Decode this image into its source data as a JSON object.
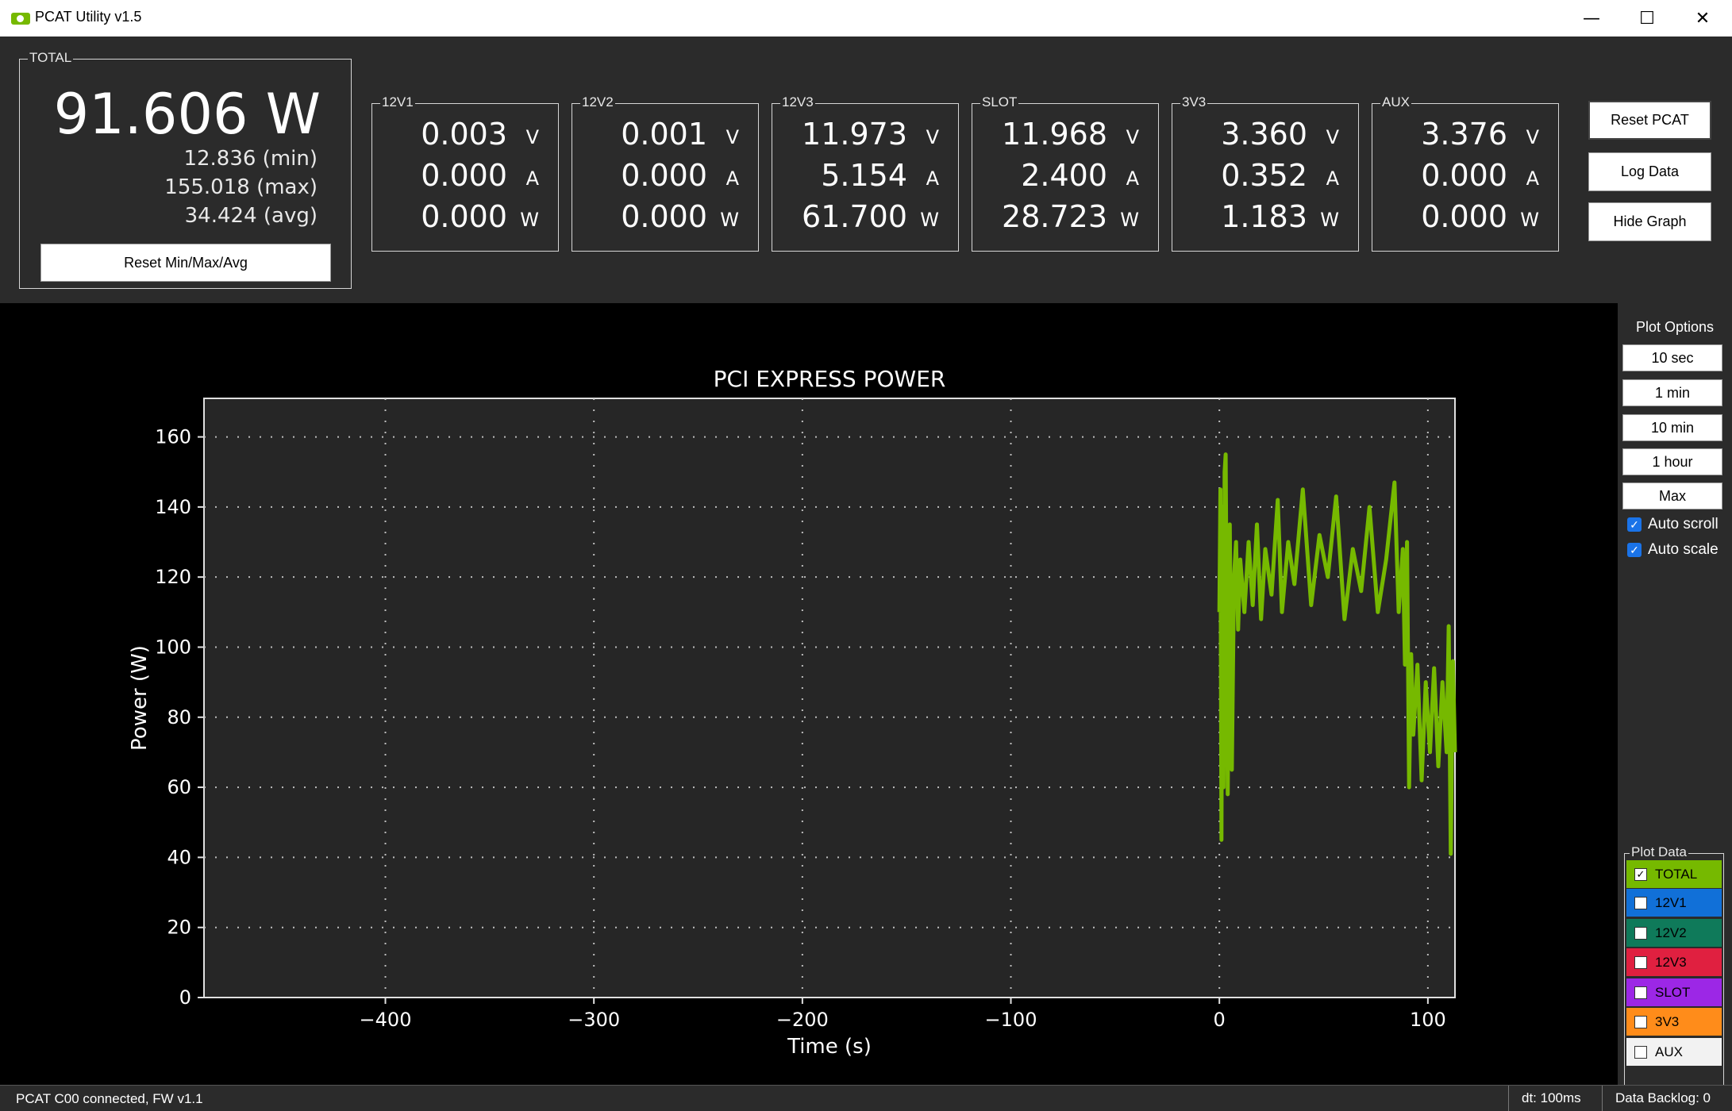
{
  "window": {
    "title": "PCAT Utility v1.5",
    "minimize": "—",
    "maximize": "☐",
    "close": "✕"
  },
  "total": {
    "label": "TOTAL",
    "power": "91.606 W",
    "min": "12.836 (min)",
    "max": "155.018 (max)",
    "avg": "34.424 (avg)",
    "reset_label": "Reset Min/Max/Avg"
  },
  "rails": [
    {
      "label": "12V1",
      "volts": "0.003",
      "amps": "0.000",
      "watts": "0.000",
      "v_unit": "V",
      "a_unit": "A",
      "w_unit": "W"
    },
    {
      "label": "12V2",
      "volts": "0.001",
      "amps": "0.000",
      "watts": "0.000",
      "v_unit": "V",
      "a_unit": "A",
      "w_unit": "W"
    },
    {
      "label": "12V3",
      "volts": "11.973",
      "amps": "5.154",
      "watts": "61.700",
      "v_unit": "V",
      "a_unit": "A",
      "w_unit": "W"
    },
    {
      "label": "SLOT",
      "volts": "11.968",
      "amps": "2.400",
      "watts": "28.723",
      "v_unit": "V",
      "a_unit": "A",
      "w_unit": "W"
    },
    {
      "label": "3V3",
      "volts": "3.360",
      "amps": "0.352",
      "watts": "1.183",
      "v_unit": "V",
      "a_unit": "A",
      "w_unit": "W"
    },
    {
      "label": "AUX",
      "volts": "3.376",
      "amps": "0.000",
      "watts": "0.000",
      "v_unit": "V",
      "a_unit": "A",
      "w_unit": "W"
    }
  ],
  "actions": {
    "reset_pcat": "Reset PCAT",
    "log_data": "Log Data",
    "hide_graph": "Hide Graph"
  },
  "plot_options": {
    "title": "Plot Options",
    "ranges": [
      "10 sec",
      "1 min",
      "10 min",
      "1 hour",
      "Max"
    ],
    "auto_scroll": "Auto scroll",
    "auto_scale": "Auto scale",
    "check_mark": "✓"
  },
  "plot_data": {
    "title": "Plot Data",
    "check_mark": "✓",
    "items": [
      {
        "label": "TOTAL",
        "color": "#76b900",
        "checked": true
      },
      {
        "label": "12V1",
        "color": "#1170d8",
        "checked": false
      },
      {
        "label": "12V2",
        "color": "#0f7a5a",
        "checked": false
      },
      {
        "label": "12V3",
        "color": "#e02040",
        "checked": false
      },
      {
        "label": "SLOT",
        "color": "#9c27e6",
        "checked": false
      },
      {
        "label": "3V3",
        "color": "#ff8c1a",
        "checked": false
      },
      {
        "label": "AUX",
        "color": "#f2f2f2",
        "checked": false
      }
    ]
  },
  "status": {
    "connection": "PCAT C00 connected, FW v1.1",
    "dt": "dt: 100ms",
    "backlog": "Data Backlog: 0"
  },
  "chart_data": {
    "type": "line",
    "title": "PCI EXPRESS POWER",
    "xlabel": "Time (s)",
    "ylabel": "Power (W)",
    "xlim": [
      -487,
      113
    ],
    "ylim": [
      0,
      171
    ],
    "xticks": [
      -400,
      -300,
      -200,
      -100,
      0,
      100
    ],
    "yticks": [
      0,
      20,
      40,
      60,
      80,
      100,
      120,
      140,
      160
    ],
    "grid": true,
    "series": [
      {
        "name": "TOTAL",
        "color": "#76b900",
        "x": [
          0,
          0.5,
          1,
          1.5,
          2,
          2.5,
          3,
          4,
          5,
          6,
          7,
          8,
          9,
          10,
          12,
          14,
          16,
          18,
          20,
          22,
          25,
          28,
          30,
          33,
          36,
          40,
          44,
          48,
          52,
          56,
          60,
          64,
          68,
          72,
          76,
          80,
          84,
          86,
          88,
          89,
          90,
          91,
          92,
          93,
          95,
          97,
          99,
          101,
          103,
          105,
          107,
          109,
          110,
          111,
          112,
          113
        ],
        "y": [
          110,
          145,
          45,
          140,
          60,
          150,
          155,
          58,
          135,
          65,
          120,
          130,
          105,
          125,
          110,
          130,
          112,
          135,
          108,
          128,
          115,
          142,
          110,
          130,
          118,
          145,
          112,
          132,
          120,
          143,
          108,
          128,
          116,
          140,
          110,
          125,
          147,
          110,
          128,
          95,
          130,
          60,
          98,
          75,
          95,
          62,
          90,
          70,
          94,
          66,
          90,
          70,
          106,
          41,
          96,
          70
        ]
      }
    ]
  }
}
